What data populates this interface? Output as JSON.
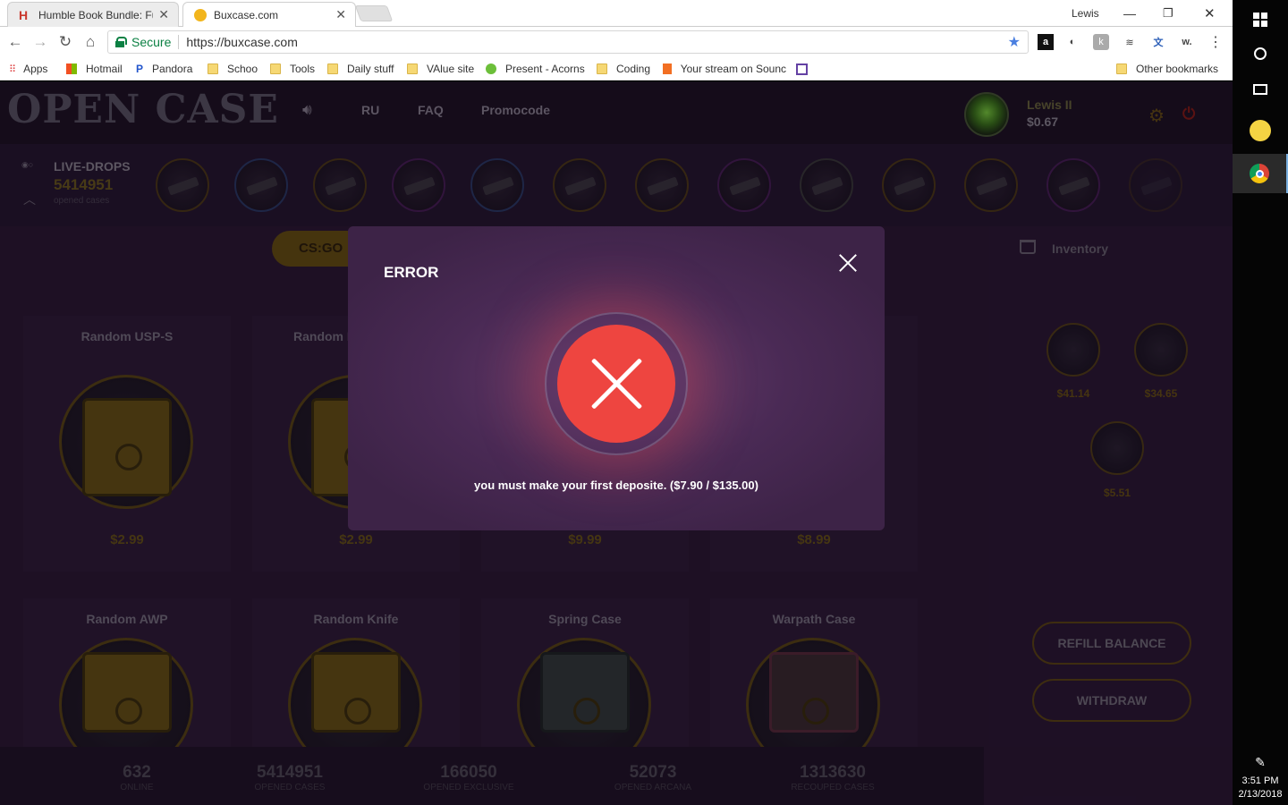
{
  "browser": {
    "tabs": [
      {
        "title": "Humble Book Bundle: Fu",
        "active": false
      },
      {
        "title": "Buxcase.com",
        "active": true
      }
    ],
    "user": "Lewis",
    "secure_label": "Secure",
    "url": "https://buxcase.com",
    "bookmarks": [
      "Apps",
      "Hotmail",
      "Pandora",
      "Schoo",
      "Tools",
      "Daily stuff",
      "VAlue site",
      "Present - Acorns",
      "Coding",
      "Your stream on Sounc",
      "Other bookmarks"
    ]
  },
  "site": {
    "logo": "OPEN CASE",
    "nav": [
      "RU",
      "FAQ",
      "Promocode"
    ],
    "user": {
      "name": "Lewis II",
      "balance": "$0.67"
    },
    "live_drops": {
      "title": "LIVE-DROPS",
      "count": "5414951",
      "sub": "opened cases"
    },
    "game_tab": "CS:GO",
    "cases_row1": [
      {
        "title": "Random USP-S",
        "price": "$2.99"
      },
      {
        "title": "Random I",
        "price": "$2.99"
      },
      {
        "title": "",
        "price": "$9.99"
      },
      {
        "title": "",
        "price": "$8.99"
      }
    ],
    "cases_row2": [
      {
        "title": "Random AWP"
      },
      {
        "title": "Random Knife"
      },
      {
        "title": "Spring Case"
      },
      {
        "title": "Warpath Case"
      }
    ],
    "inventory": {
      "label": "Inventory",
      "prices": [
        "$41.14",
        "$34.65",
        "$5.51"
      ]
    },
    "buttons": {
      "refill": "REFILL BALANCE",
      "withdraw": "WITHDRAW"
    },
    "stats": [
      {
        "num": "632",
        "label": "ONLINE"
      },
      {
        "num": "5414951",
        "label": "OPENED CASES"
      },
      {
        "num": "166050",
        "label": "OPENED EXCLUSIVE"
      },
      {
        "num": "52073",
        "label": "OPENED ARCANA"
      },
      {
        "num": "1313630",
        "label": "RECOUPED CASES"
      }
    ]
  },
  "modal": {
    "title": "ERROR",
    "message": "you must make your first deposite. ($7.90 / $135.00)"
  },
  "taskbar": {
    "time": "3:51 PM",
    "date": "2/13/2018"
  }
}
